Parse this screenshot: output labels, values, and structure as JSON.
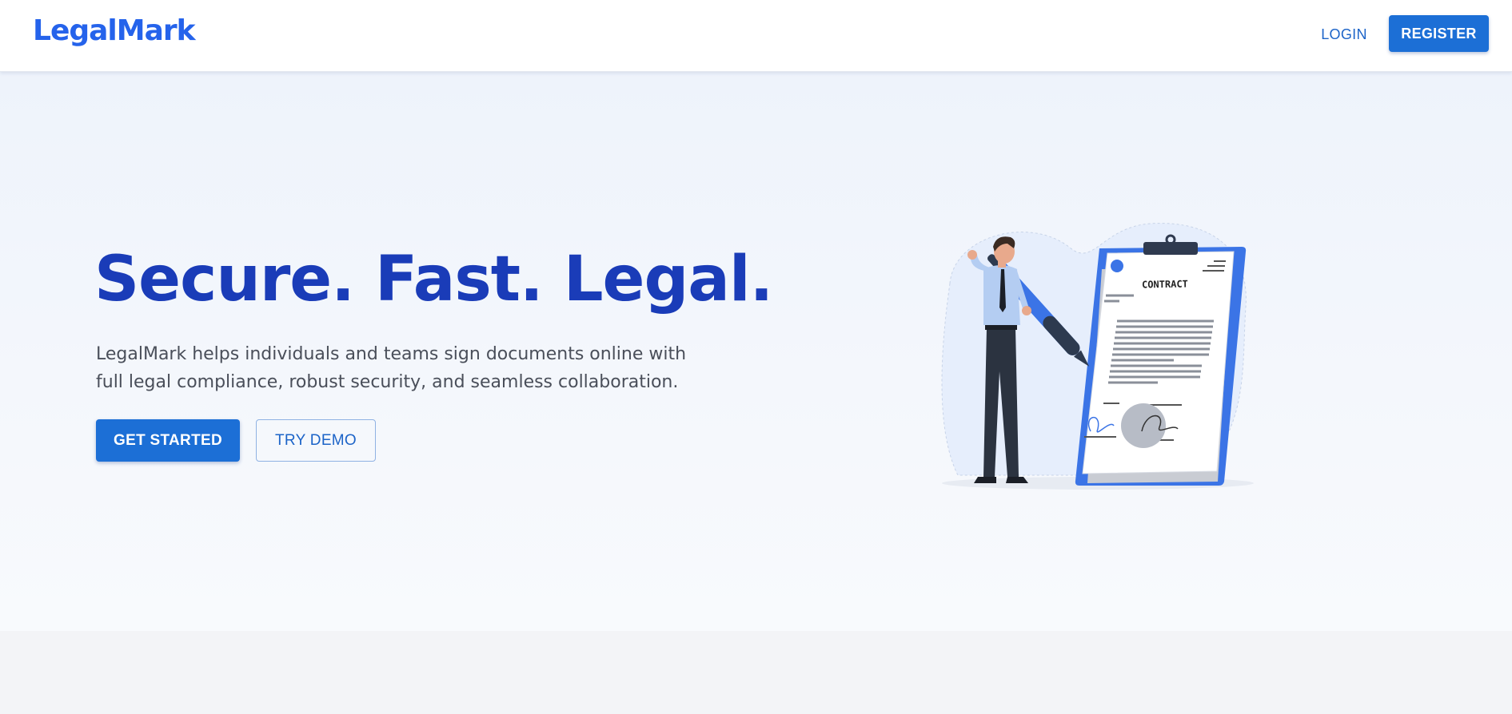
{
  "header": {
    "logo_text": "LegalMark",
    "login_label": "LOGIN",
    "register_label": "REGISTER"
  },
  "hero": {
    "title": "Secure. Fast. Legal.",
    "description": "LegalMark helps individuals and teams sign documents online with full legal compliance, robust security, and seamless collaboration.",
    "get_started_label": "GET STARTED",
    "try_demo_label": "TRY DEMO",
    "illustration": {
      "icon": "contract-signing-illustration",
      "document_title": "CONTRACT"
    }
  },
  "colors": {
    "brand": "#2563eb",
    "primary_button": "#1c6fd6",
    "hero_title": "#1a3cb8",
    "body_text": "#4a4f5a"
  }
}
